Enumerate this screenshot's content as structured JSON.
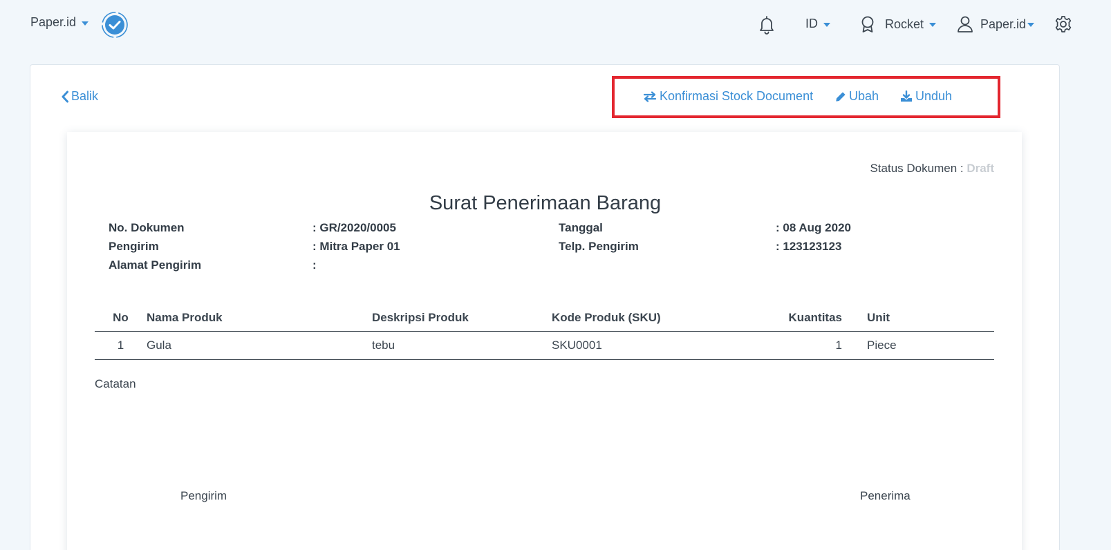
{
  "topbar": {
    "brand": "Paper.id",
    "language": "ID",
    "plan": "Rocket",
    "user": "Paper.id",
    "icons": {
      "brand_check": "verified-check-icon",
      "notifications": "bell-icon",
      "plan": "badge-icon",
      "user": "user-icon",
      "settings": "gear-icon"
    }
  },
  "toolbar": {
    "back_label": "Balik",
    "confirm_label": "Konfirmasi Stock Document",
    "edit_label": "Ubah",
    "download_label": "Unduh"
  },
  "document": {
    "status_label": "Status Dokumen :",
    "status_value": "Draft",
    "title": "Surat Penerimaan Barang",
    "meta": {
      "doc_no_label": "No. Dokumen",
      "doc_no_value": ": GR/2020/0005",
      "sender_label": "Pengirim",
      "sender_value": ": Mitra Paper 01",
      "sender_address_label": "Alamat Pengirim",
      "sender_address_value": ":",
      "date_label": "Tanggal",
      "date_value": ": 08 Aug 2020",
      "sender_phone_label": "Telp. Pengirim",
      "sender_phone_value": ": 123123123"
    },
    "table": {
      "headers": [
        "No",
        "Nama Produk",
        "Deskripsi Produk",
        "Kode Produk (SKU)",
        "Kuantitas",
        "Unit"
      ],
      "rows": [
        [
          "1",
          "Gula",
          "tebu",
          "SKU0001",
          "1",
          "Piece"
        ]
      ]
    },
    "note_label": "Catatan",
    "signature_sender": "Pengirim",
    "signature_receiver": "Penerima"
  },
  "colors": {
    "accent": "#3b8fd6",
    "highlight_box": "#e3262f",
    "background": "#f2f7fb",
    "draft_status": "#c8cdd2"
  }
}
